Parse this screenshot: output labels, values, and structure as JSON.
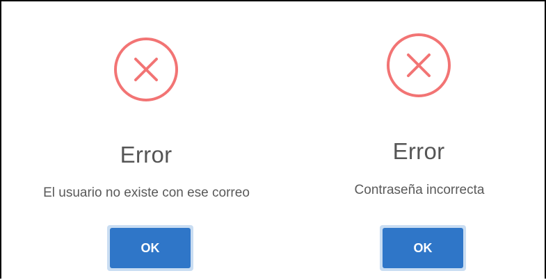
{
  "dialogs": [
    {
      "icon": "error-x-icon",
      "title": "Error",
      "message": "El usuario no existe con ese correo",
      "ok_label": "OK"
    },
    {
      "icon": "error-x-icon",
      "title": "Error",
      "message": "Contraseña incorrecta",
      "ok_label": "OK"
    }
  ],
  "colors": {
    "error_icon": "#f27474",
    "ok_button": "#2f76c8",
    "ok_button_focus_ring": "#c9ddf2",
    "title_text": "#555555",
    "message_text": "#595959"
  }
}
